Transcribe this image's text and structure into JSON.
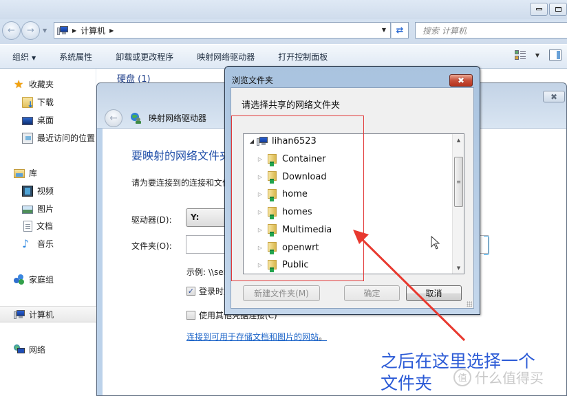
{
  "explorer": {
    "address": {
      "crumb": "计算机",
      "icon": "computer-icon"
    },
    "search": {
      "placeholder": "搜索 计算机"
    },
    "toolbar": {
      "organize": "组织",
      "items": [
        "系统属性",
        "卸载或更改程序",
        "映射网络驱动器",
        "打开控制面板"
      ]
    },
    "behind_section_header": "硬盘 (1)",
    "sidebar": {
      "favorites": {
        "label": "收藏夹",
        "icon": "star-icon"
      },
      "favorites_items": [
        {
          "label": "下载",
          "icon": "downloads-folder-icon"
        },
        {
          "label": "桌面",
          "icon": "desktop-icon"
        },
        {
          "label": "最近访问的位置",
          "icon": "recent-places-icon"
        }
      ],
      "libraries": {
        "label": "库",
        "icon": "library-icon"
      },
      "library_items": [
        {
          "label": "视频",
          "icon": "video-icon"
        },
        {
          "label": "图片",
          "icon": "pictures-icon"
        },
        {
          "label": "文档",
          "icon": "documents-icon"
        },
        {
          "label": "音乐",
          "icon": "music-icon"
        }
      ],
      "homegroup": {
        "label": "家庭组",
        "icon": "homegroup-icon"
      },
      "computer": {
        "label": "计算机",
        "icon": "computer-icon",
        "selected": true
      },
      "network": {
        "label": "网络",
        "icon": "network-icon"
      }
    }
  },
  "map_drive_wizard": {
    "title": "映射网络驱动器",
    "heading": "要映射的网络文件夹",
    "description": "请为要连接到的连接和文件夹指定驱动器号:",
    "drive_label": "驱动器(D):",
    "drive_value": "Y:",
    "folder_label": "文件夹(O):",
    "folder_value": "",
    "example": "示例: \\\\server\\share",
    "reconnect_label": "登录时重新连接(R)",
    "reconnect_checked": true,
    "other_creds_label": "使用其他凭据连接(C)",
    "other_creds_checked": false,
    "link": "连接到可用于存储文档和图片的网站",
    "link_suffix": "。"
  },
  "browse_dialog": {
    "title": "浏览文件夹",
    "prompt": "请选择共享的网络文件夹",
    "tree": {
      "root": {
        "label": "lihan6523",
        "expanded": true
      },
      "children": [
        "Container",
        "Download",
        "home",
        "homes",
        "Multimedia",
        "openwrt",
        "Public"
      ]
    },
    "buttons": {
      "new_folder": "新建文件夹(M)",
      "ok": "确定",
      "cancel": "取消"
    }
  },
  "annotation": {
    "caption_line1": "之后在这里选择一个",
    "caption_line2": "文件夹",
    "color": "#e8392f"
  },
  "watermark": {
    "badge": "值",
    "text": "什么值得买"
  }
}
